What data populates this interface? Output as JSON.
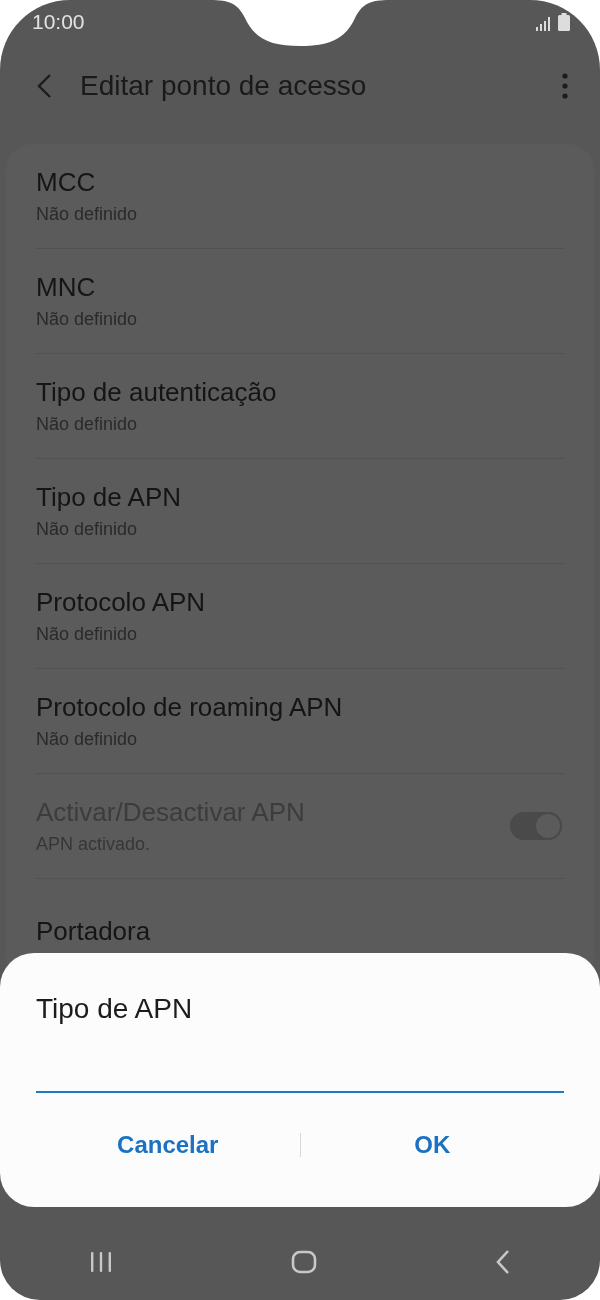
{
  "status_bar": {
    "time": "10:00"
  },
  "app_bar": {
    "title": "Editar ponto de acesso"
  },
  "settings": [
    {
      "kind": "text",
      "title": "MCC",
      "summary": "Não definido",
      "disabled": false
    },
    {
      "kind": "text",
      "title": "MNC",
      "summary": "Não definido",
      "disabled": false
    },
    {
      "kind": "text",
      "title": "Tipo de autenticação",
      "summary": "Não definido",
      "disabled": false
    },
    {
      "kind": "text",
      "title": "Tipo de APN",
      "summary": "Não definido",
      "disabled": false
    },
    {
      "kind": "text",
      "title": "Protocolo APN",
      "summary": "Não definido",
      "disabled": false
    },
    {
      "kind": "text",
      "title": "Protocolo de roaming APN",
      "summary": "Não definido",
      "disabled": false
    },
    {
      "kind": "switch",
      "title": "Activar/Desactivar APN",
      "summary": "APN activado.",
      "disabled": true,
      "on": true
    },
    {
      "kind": "text",
      "title": "Portadora",
      "disabled": false
    }
  ],
  "dialog": {
    "title": "Tipo de APN",
    "buttons": [
      "Cancelar",
      "OK"
    ]
  }
}
